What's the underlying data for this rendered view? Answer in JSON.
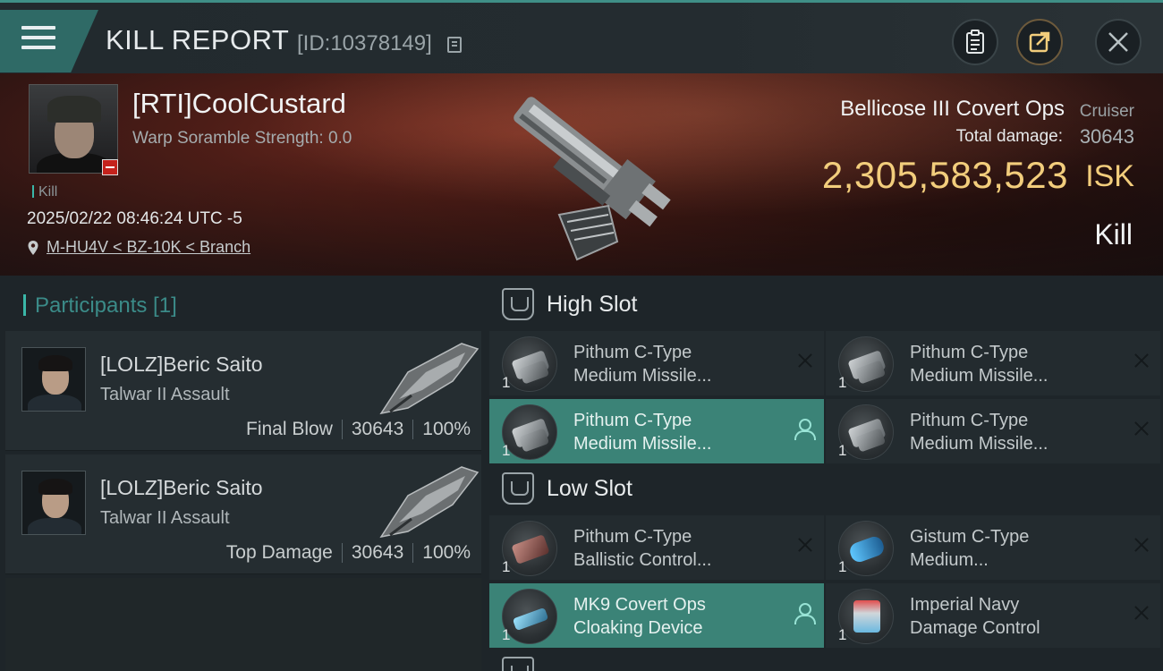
{
  "header": {
    "title": "KILL REPORT",
    "report_id": "[ID:10378149]",
    "icons": [
      "menu-icon",
      "copy-icon",
      "clipboard-icon",
      "share-icon",
      "close-icon"
    ]
  },
  "victim": {
    "name": "[RTI]CoolCustard",
    "warp": "Warp Soramble Strength: 0.0",
    "tag": "Kill",
    "timestamp": "2025/02/22 08:46:24 UTC -5",
    "location": "M-HU4V < BZ-10K < Branch",
    "ship_name": "Bellicose III Covert Ops",
    "ship_class": "Cruiser",
    "total_damage_label": "Total damage:",
    "total_damage": "30643",
    "isk_value": "2,305,583,523",
    "isk_unit": "ISK",
    "result": "Kill"
  },
  "participants": {
    "header": "Participants [1]",
    "items": [
      {
        "name": "[LOLZ]Beric Saito",
        "ship": "Talwar II Assault",
        "role": "Final Blow",
        "damage": "30643",
        "percent": "100%"
      },
      {
        "name": "[LOLZ]Beric Saito",
        "ship": "Talwar II Assault",
        "role": "Top Damage",
        "damage": "30643",
        "percent": "100%"
      }
    ]
  },
  "fittings": {
    "high_slot_label": "High Slot",
    "low_slot_label": "Low Slot",
    "high": [
      {
        "line1": "Pithum C-Type",
        "line2": "Medium Missile...",
        "qty": "1",
        "active": false
      },
      {
        "line1": "Pithum C-Type",
        "line2": "Medium Missile...",
        "qty": "1",
        "active": false
      },
      {
        "line1": "Pithum C-Type",
        "line2": "Medium Missile...",
        "qty": "1",
        "active": true
      },
      {
        "line1": "Pithum C-Type",
        "line2": "Medium Missile...",
        "qty": "1",
        "active": false
      }
    ],
    "low": [
      {
        "line1": "Pithum C-Type",
        "line2": "Ballistic Control...",
        "qty": "1",
        "active": false
      },
      {
        "line1": "Gistum C-Type",
        "line2": "Medium...",
        "qty": "1",
        "active": false
      },
      {
        "line1": "MK9 Covert Ops",
        "line2": "Cloaking Device",
        "qty": "1",
        "active": true
      },
      {
        "line1": "Imperial Navy",
        "line2": "Damage Control",
        "qty": "1",
        "active": false
      }
    ]
  },
  "colors": {
    "accent": "#3ab7a8",
    "isk": "#f2cd7c",
    "active_row": "#3b8377",
    "banner": "#4d1d17"
  }
}
